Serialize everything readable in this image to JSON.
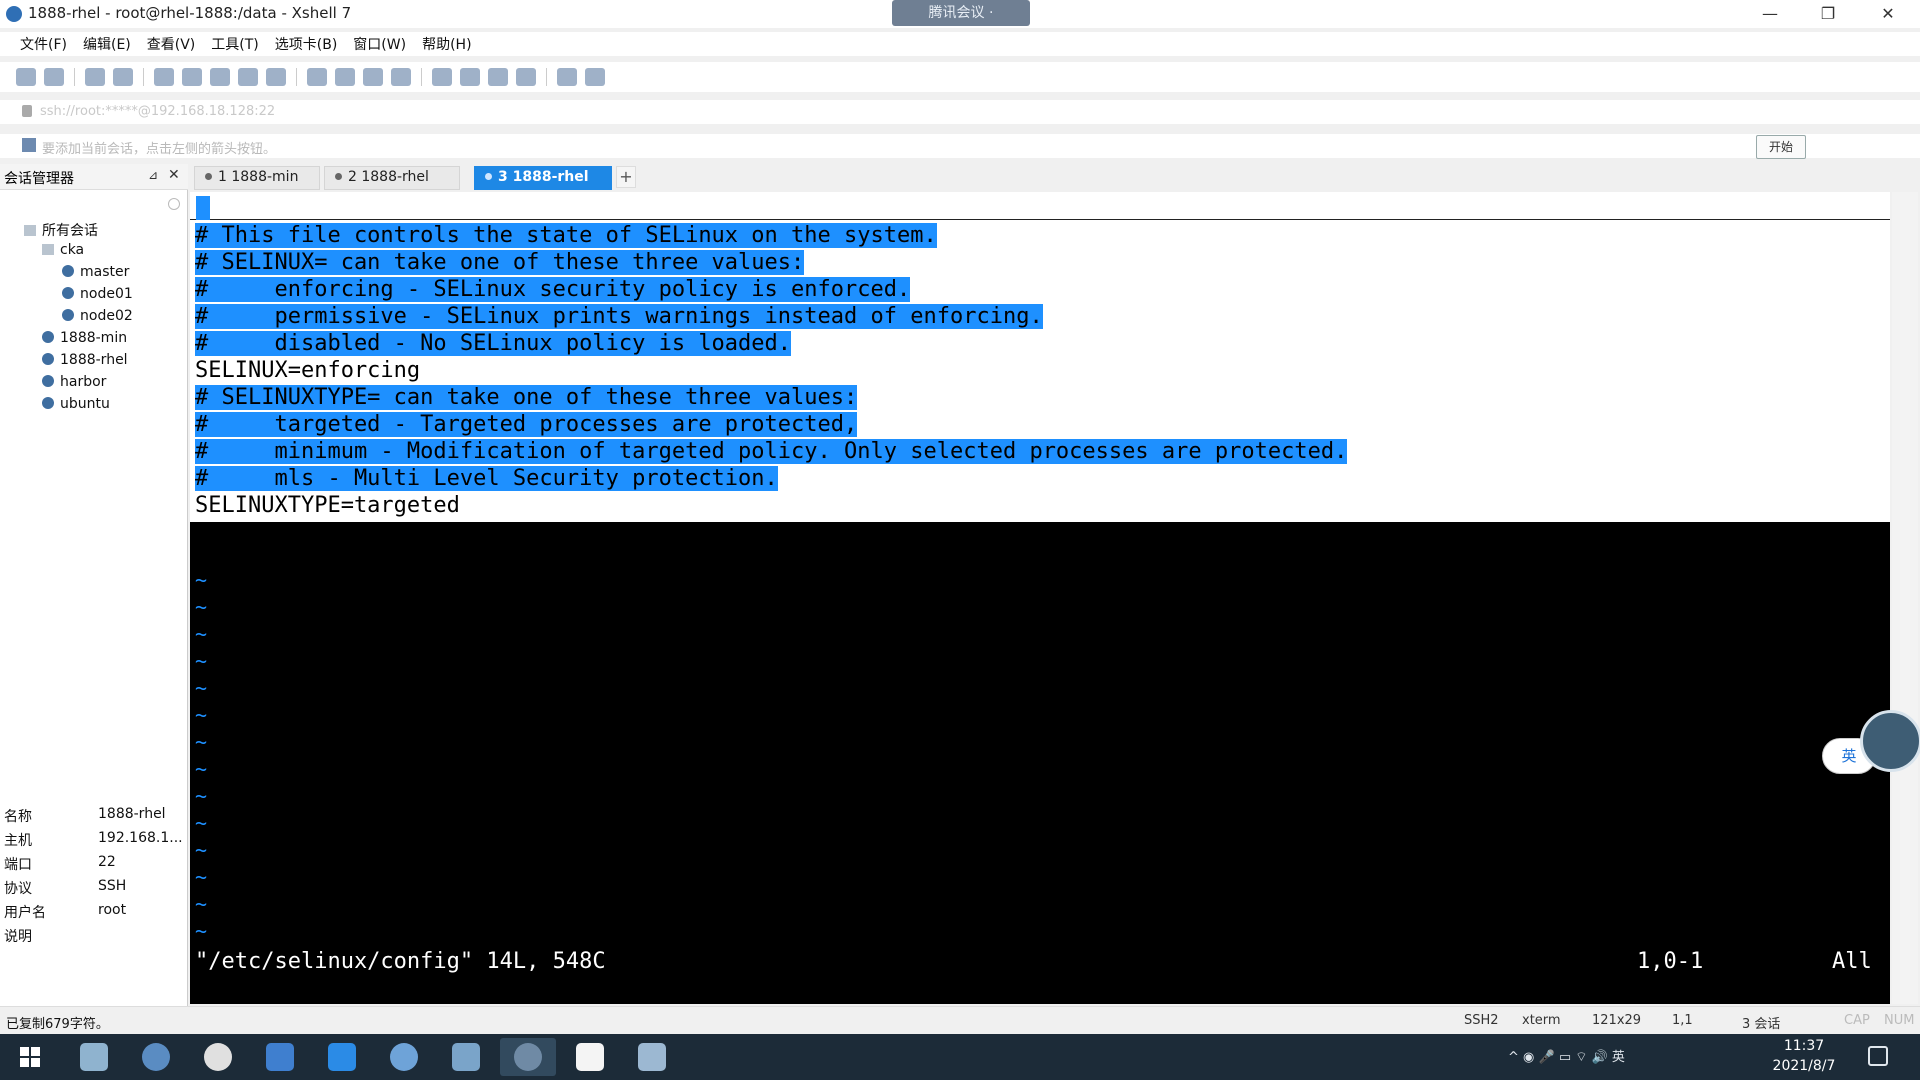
{
  "window": {
    "title": "1888-rhel - root@rhel-1888:/data - Xshell 7",
    "meeting_badge": "腾讯会议 ·",
    "minimize": "—",
    "restore": "❐",
    "close": "✕"
  },
  "menu": [
    "文件(F)",
    "编辑(E)",
    "查看(V)",
    "工具(T)",
    "选项卡(B)",
    "窗口(W)",
    "帮助(H)"
  ],
  "addressbar": {
    "address": "ssh://root:*****@192.168.18.128:22"
  },
  "infobar": {
    "text": "要添加当前会话，点击左侧的箭头按钮。",
    "start_button": "开始"
  },
  "session_manager": {
    "title": "会话管理器",
    "pin": "⊿",
    "close": "✕",
    "tree": [
      {
        "label": "所有会话",
        "level": 0,
        "type": "folder"
      },
      {
        "label": "cka",
        "level": 1,
        "type": "folder"
      },
      {
        "label": "master",
        "level": 2,
        "type": "session"
      },
      {
        "label": "node01",
        "level": 2,
        "type": "session"
      },
      {
        "label": "node02",
        "level": 2,
        "type": "session"
      },
      {
        "label": "1888-min",
        "level": 1,
        "type": "session"
      },
      {
        "label": "1888-rhel",
        "level": 1,
        "type": "session"
      },
      {
        "label": "harbor",
        "level": 1,
        "type": "session"
      },
      {
        "label": "ubuntu",
        "level": 1,
        "type": "session"
      }
    ],
    "properties": [
      {
        "key": "名称",
        "value": "1888-rhel"
      },
      {
        "key": "主机",
        "value": "192.168.1..."
      },
      {
        "key": "端口",
        "value": "22"
      },
      {
        "key": "协议",
        "value": "SSH"
      },
      {
        "key": "用户名",
        "value": "root"
      },
      {
        "key": "说明",
        "value": ""
      }
    ]
  },
  "tabs": [
    {
      "label": "1 1888-min",
      "active": false
    },
    {
      "label": "2 1888-rhel",
      "active": false
    },
    {
      "label": "3 1888-rhel",
      "active": true
    }
  ],
  "add_tab": "+",
  "terminal": {
    "lines": [
      {
        "text": "# This file controls the state of SELinux on the system.",
        "highlight": true
      },
      {
        "text": "# SELINUX= can take one of these three values:",
        "highlight": true
      },
      {
        "text": "#     enforcing - SELinux security policy is enforced.",
        "highlight": true
      },
      {
        "text": "#     permissive - SELinux prints warnings instead of enforcing.",
        "highlight": true
      },
      {
        "text": "#     disabled - No SELinux policy is loaded.",
        "highlight": true
      },
      {
        "text": "SELINUX=enforcing",
        "highlight": false
      },
      {
        "text": "# SELINUXTYPE= can take one of these three values:",
        "highlight": true
      },
      {
        "text": "#     targeted - Targeted processes are protected,",
        "highlight": true
      },
      {
        "text": "#     minimum - Modification of targeted policy. Only selected processes are protected.",
        "highlight": true
      },
      {
        "text": "#     mls - Multi Level Security protection.",
        "highlight": true
      },
      {
        "text": "SELINUXTYPE=targeted",
        "highlight": false
      }
    ],
    "tilde": "~",
    "tilde_count": 14,
    "file_status": "\"/etc/selinux/config\" 14L, 548C",
    "cursor_pos": "1,0-1",
    "scroll_pos": "All"
  },
  "ime": {
    "label": "英"
  },
  "statusbar": {
    "left": "已复制679字符。",
    "protocol": "SSH2",
    "term": "xterm",
    "size": "121x29",
    "pos": "1,1",
    "sessions": "3 会话",
    "caps": "CAP",
    "num": "NUM"
  },
  "taskbar": {
    "tray_text": "^  ◉  🎤  ▭  ⌔  🔊  英",
    "time": "11:37",
    "date": "2021/8/7",
    "apps": [
      "windows-start",
      "photos",
      "browser",
      "wechat",
      "multi-window",
      "cloud-drive",
      "netease-music",
      "file-explorer",
      "xshell",
      "typora",
      "image-viewer"
    ]
  },
  "colors": {
    "selection": "#1e90ff",
    "accent": "#1e88e5",
    "taskbar": "#1c2b38"
  }
}
